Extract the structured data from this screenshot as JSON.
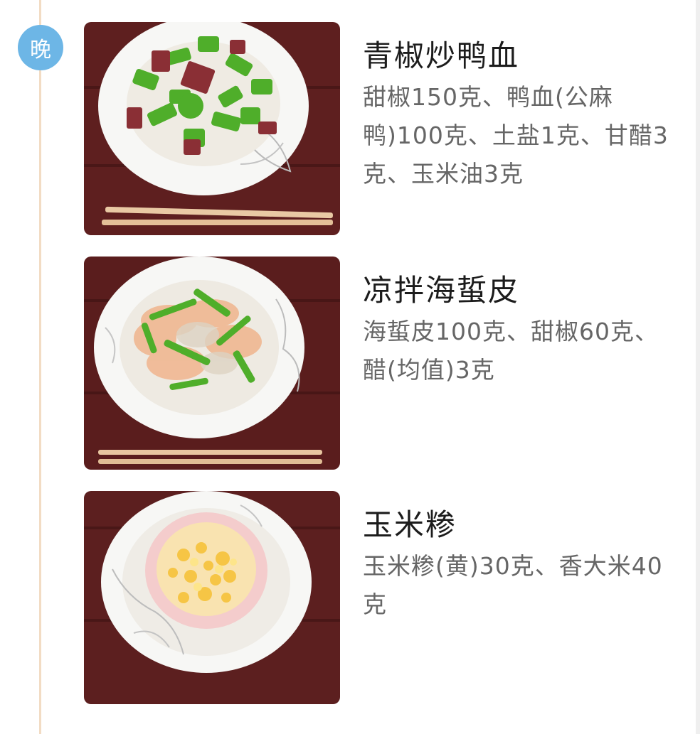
{
  "meal": {
    "badge": "晚"
  },
  "dishes": [
    {
      "name": "青椒炒鸭血",
      "ingredients": "甜椒150克、鸭血(公麻鸭)100克、土盐1克、甘醋3克、玉米油3克",
      "photo_icon": "stir-fried-pepper-duck-blood"
    },
    {
      "name": "凉拌海蜇皮",
      "ingredients": "海蜇皮100克、甜椒60克、醋(均值)3克",
      "photo_icon": "jellyfish-salad"
    },
    {
      "name": "玉米糁",
      "ingredients": "玉米糁(黄)30克、香大米40克",
      "photo_icon": "cornmeal-porridge"
    }
  ],
  "colors": {
    "badge_bg": "#6db6e6",
    "timeline": "#f2dcc4",
    "table_wood": "#5e1f1f",
    "plate": "#f7f7f5",
    "pepper_green": "#4fae2a"
  }
}
